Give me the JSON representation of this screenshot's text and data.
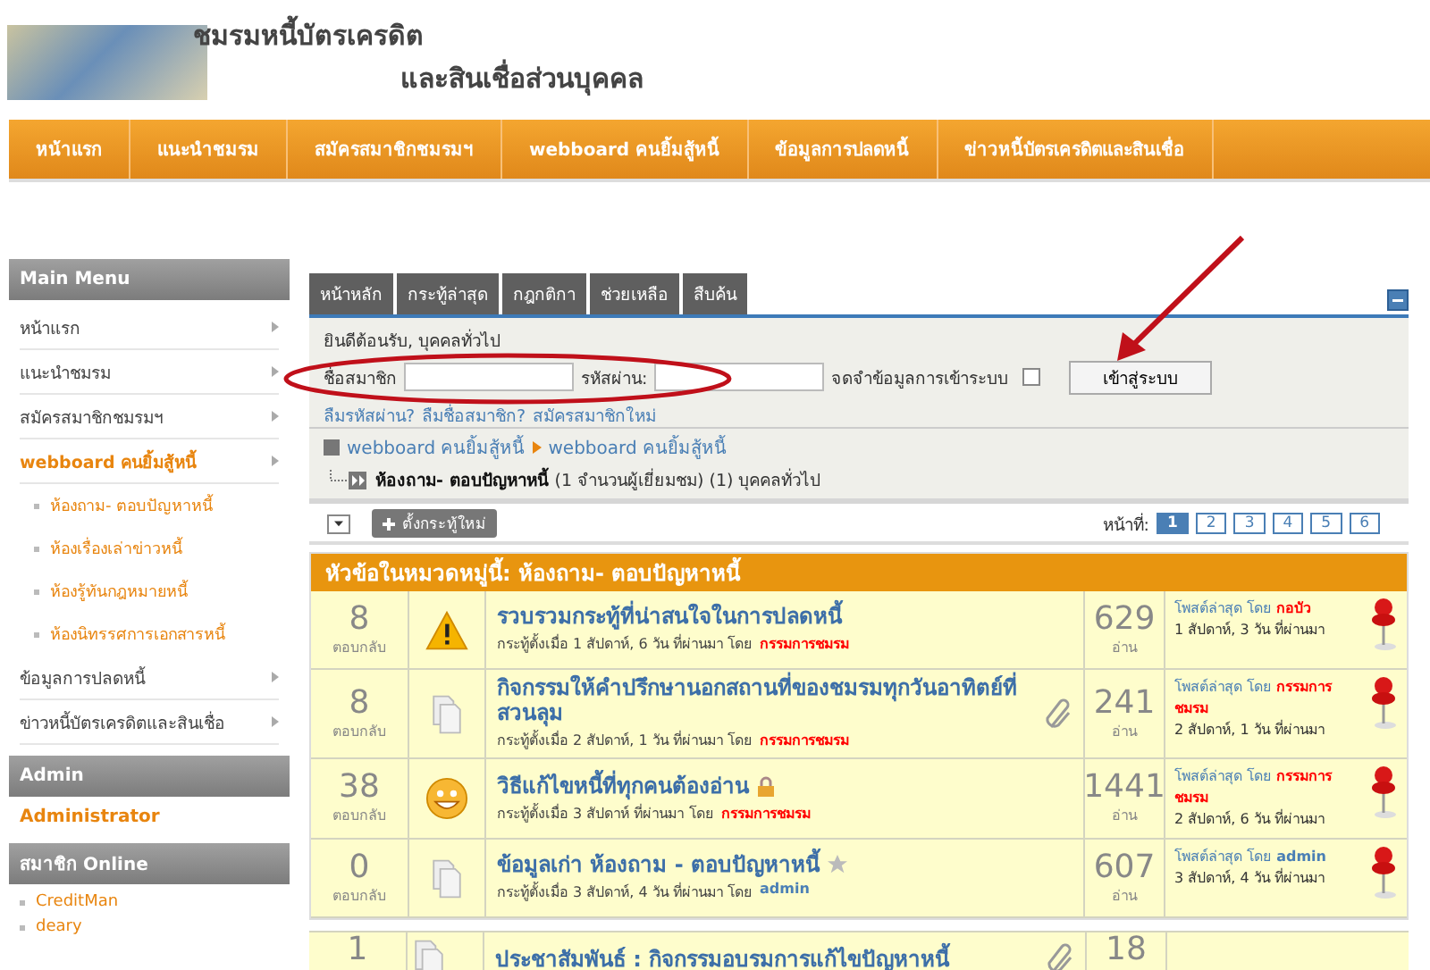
{
  "site": {
    "title_line_1": "ชมรมหนี้บัตรเครดิต",
    "title_line_2": "และสินเชื่อส่วนบุคคล"
  },
  "nav": [
    {
      "label": "หน้าแรก"
    },
    {
      "label": "แนะนำชมรม"
    },
    {
      "label": "สมัครสมาชิกชมรมฯ"
    },
    {
      "label": "webboard คนยิ้มสู้หนี้"
    },
    {
      "label": "ข้อมูลการปลดหนี้"
    },
    {
      "label": "ข่าวหนี้บัตรเครดิตและสินเชื่อ"
    }
  ],
  "sidebar": [
    {
      "title": "Main Menu",
      "kind": "menu",
      "items": [
        {
          "label": "หน้าแรก",
          "selected": false
        },
        {
          "label": "แนะนำชมรม",
          "selected": false
        },
        {
          "label": "สมัครสมาชิกชมรมฯ",
          "selected": false
        },
        {
          "label": "webboard คนยิ้มสู้หนี้",
          "selected": true,
          "children": [
            {
              "label": "ห้องถาม- ตอบปัญหาหนี้"
            },
            {
              "label": "ห้องเรื่องเล่าข่าวหนี้"
            },
            {
              "label": "ห้องรู้ทันกฎหมายหนี้"
            },
            {
              "label": "ห้องนิทรรศการเอกสารหนี้"
            }
          ]
        },
        {
          "label": "ข้อมูลการปลดหนี้",
          "selected": false
        },
        {
          "label": "ข่าวหนี้บัตรเครดิตและสินเชื่อ",
          "selected": false
        }
      ]
    },
    {
      "title": "Admin",
      "kind": "names",
      "items": [
        {
          "label": "Administrator"
        }
      ]
    },
    {
      "title": "สมาชิก Online",
      "kind": "users",
      "items": [
        {
          "label": "CreditMan"
        },
        {
          "label": "deary"
        }
      ]
    }
  ],
  "tabs": [
    {
      "label": "หน้าหลัก"
    },
    {
      "label": "กระทู้ล่าสุด"
    },
    {
      "label": "กฎกติกา"
    },
    {
      "label": "ช่วยเหลือ"
    },
    {
      "label": "สืบค้น"
    }
  ],
  "login": {
    "greeting": "ยินดีต้อนรับ, บุคคลทั่วไป",
    "username_label": "ชื่อสมาชิก",
    "password_label": "รหัสผ่าน:",
    "remember_label": "จดจำข้อมูลการเข้าระบบ",
    "remember_checked": false,
    "submit": "เข้าสู่ระบบ",
    "links": [
      "ลืมรหัสผ่าน?",
      "ลืมชื่อสมาชิก?",
      "สมัครสมาชิกใหม่"
    ]
  },
  "breadcrumb": [
    "webboard คนยิ้มสู้หนี้",
    "webboard คนยิ้มสู้หนี้"
  ],
  "forum": {
    "name": "ห้องถาม- ตอบปัญหาหนี้",
    "viewers": "(1 จำนวนผู้เยี่ยมชม) (1) บุคคลทั่วไป"
  },
  "toolbar": {
    "new_topic": "ตั้งกระทู้ใหม่",
    "page_label": "หน้าที่:",
    "pages": [
      {
        "label": "1",
        "selected": true
      },
      {
        "label": "2",
        "selected": false
      },
      {
        "label": "3",
        "selected": false
      },
      {
        "label": "4",
        "selected": false
      },
      {
        "label": "5",
        "selected": false
      },
      {
        "label": "6",
        "selected": false
      }
    ]
  },
  "topics": {
    "heading": "หัวข้อในหมวดหมู่นี้: ห้องถาม- ตอบปัญหาหนี้",
    "rows": [
      {
        "replies": "8",
        "replies_label": "ตอบกลับ",
        "kind": "warning",
        "title": "รวบรวมกระทู้ที่น่าสนใจในการปลดหนี้",
        "meta": "กระทู้ตั้งเมื่อ 1 สัปดาห์, 6 วัน ที่ผ่านมา  โดย",
        "author": {
          "name": "กรรมการชมรม",
          "color": "#ff0000"
        },
        "attachment": false,
        "locked": false,
        "starred": false,
        "views": "629",
        "views_label": "อ่าน",
        "last_post_label": "โพสต์ล่าสุด โดย",
        "last_author": {
          "name": "กอบัว",
          "color": "#ff0000"
        },
        "last_time": "1 สัปดาห์, 3 วัน ที่ผ่านมา",
        "pinned": true
      },
      {
        "replies": "8",
        "replies_label": "ตอบกลับ",
        "kind": "document",
        "title": "กิจกรรมให้คำปรึกษานอกสถานที่ของชมรมทุกวันอาทิตย์ที่สวนลุม",
        "meta": "กระทู้ตั้งเมื่อ 2 สัปดาห์, 1 วัน ที่ผ่านมา  โดย",
        "author": {
          "name": "กรรมการชมรม",
          "color": "#ff0000"
        },
        "attachment": true,
        "locked": false,
        "starred": false,
        "views": "241",
        "views_label": "อ่าน",
        "last_post_label": "โพสต์ล่าสุด โดย",
        "last_author": {
          "name": "กรรมการชมรม",
          "color": "#ff0000"
        },
        "last_time": "2 สัปดาห์, 1 วัน ที่ผ่านมา",
        "pinned": true
      },
      {
        "replies": "38",
        "replies_label": "ตอบกลับ",
        "kind": "smiley",
        "title": "วิธีแก้ไขหนี้ที่ทุกคนต้องอ่าน",
        "meta": "กระทู้ตั้งเมื่อ 3 สัปดาห์ ที่ผ่านมา  โดย",
        "author": {
          "name": "กรรมการชมรม",
          "color": "#ff0000"
        },
        "attachment": false,
        "locked": true,
        "starred": false,
        "views": "1441",
        "views_label": "อ่าน",
        "last_post_label": "โพสต์ล่าสุด โดย",
        "last_author": {
          "name": "กรรมการชมรม",
          "color": "#ff0000"
        },
        "last_time": "2 สัปดาห์, 6 วัน ที่ผ่านมา",
        "pinned": true
      },
      {
        "replies": "0",
        "replies_label": "ตอบกลับ",
        "kind": "document",
        "title": "ข้อมูลเก่า ห้องถาม - ตอบปัญหาหนี้",
        "meta": "กระทู้ตั้งเมื่อ 3 สัปดาห์, 4 วัน ที่ผ่านมา  โดย",
        "author": {
          "name": "admin",
          "color": "#4a7fb5"
        },
        "attachment": false,
        "locked": false,
        "starred": true,
        "views": "607",
        "views_label": "อ่าน",
        "last_post_label": "โพสต์ล่าสุด โดย",
        "last_author": {
          "name": "admin",
          "color": "#4a7fb5"
        },
        "last_time": "3 สัปดาห์, 4 วัน ที่ผ่านมา",
        "pinned": true
      }
    ]
  },
  "more_topics": [
    {
      "replies": "1",
      "kind": "document",
      "title": "ประชาสัมพันธ์ : กิจกรรมอบรมการแก้ไขปัญหาหนี้",
      "attachment": true,
      "views": "18"
    }
  ]
}
